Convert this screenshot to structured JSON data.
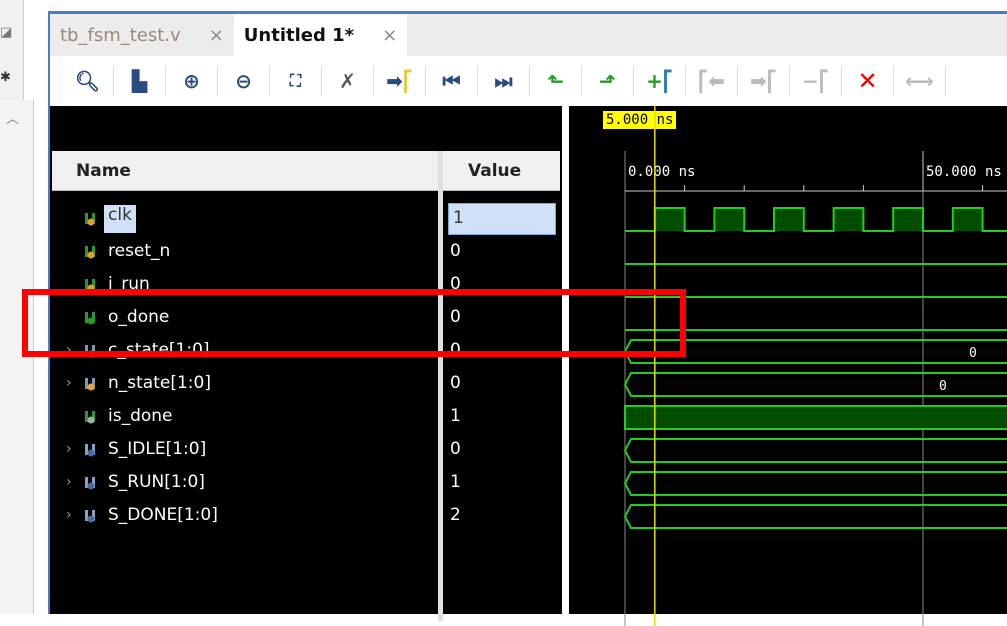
{
  "tabs": [
    {
      "label": "tb_fsm_test.v",
      "active": false
    },
    {
      "label": "Untitled 1*",
      "active": true
    }
  ],
  "toolbar": [
    "search-icon",
    "save-icon",
    "zoom-in-icon",
    "zoom-out-icon",
    "zoom-fit-icon",
    "cursor-snap-icon",
    "go-to-cursor-icon",
    "go-to-time-zero-icon",
    "go-to-last-time-icon",
    "previous-transition-icon",
    "next-transition-icon",
    "add-marker-icon",
    "previous-marker-icon",
    "next-marker-icon",
    "delete-marker-icon",
    "delete-all-markers-icon",
    "swap-cursors-icon"
  ],
  "columns": {
    "name": "Name",
    "value": "Value"
  },
  "cursor": {
    "label": "5.000 ns",
    "time_ns": 5
  },
  "time_labels": [
    {
      "label": "0.000 ns",
      "t": 0
    },
    {
      "label": "50.000 ns",
      "t": 50
    }
  ],
  "signals": [
    {
      "name": "clk",
      "value": "1",
      "type": "input",
      "kind": "clock",
      "selected": true
    },
    {
      "name": "reset_n",
      "value": "0",
      "type": "input",
      "kind": "low"
    },
    {
      "name": "i_run",
      "value": "0",
      "type": "input",
      "kind": "low"
    },
    {
      "name": "o_done",
      "value": "0",
      "type": "output",
      "kind": "low"
    },
    {
      "name": "c_state[1:0]",
      "value": "0",
      "type": "bus",
      "kind": "bus",
      "expandable": true,
      "wave_label": "0"
    },
    {
      "name": "n_state[1:0]",
      "value": "0",
      "type": "bus",
      "kind": "bus",
      "expandable": true,
      "wave_label": "0"
    },
    {
      "name": "is_done",
      "value": "1",
      "type": "internal",
      "kind": "high"
    },
    {
      "name": "S_IDLE[1:0]",
      "value": "0",
      "type": "const",
      "kind": "bus",
      "expandable": true
    },
    {
      "name": "S_RUN[1:0]",
      "value": "1",
      "type": "const",
      "kind": "bus",
      "expandable": true
    },
    {
      "name": "S_DONE[1:0]",
      "value": "2",
      "type": "const",
      "kind": "bus",
      "expandable": true
    }
  ],
  "colors": {
    "wave": "#22cc22",
    "wave_fill": "#004d00",
    "cursor": "#e0e000",
    "highlight": "#ff0000"
  }
}
